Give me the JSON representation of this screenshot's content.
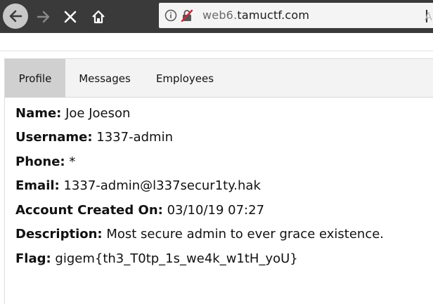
{
  "browser": {
    "url_prefix": "web6.",
    "url_domain": "tamuctf.com",
    "colors": {
      "toolbar": "#3a3a3a",
      "address_bg": "#f4f4f4",
      "insecure_icon": "#d2253a"
    },
    "icons": [
      "back-icon",
      "forward-icon",
      "close-icon",
      "home-icon",
      "info-icon",
      "insecure-lock-icon"
    ],
    "overflow_glyph": "A"
  },
  "tabs": [
    {
      "label": "Profile",
      "active": true
    },
    {
      "label": "Messages",
      "active": false
    },
    {
      "label": "Employees",
      "active": false
    }
  ],
  "profile": {
    "fields": [
      {
        "label": "Name:",
        "value": " Joe Joeson"
      },
      {
        "label": "Username:",
        "value": " 1337-admin"
      },
      {
        "label": "Phone:",
        "value": " *"
      },
      {
        "label": "Email:",
        "value": " 1337-admin@l337secur1ty.hak"
      },
      {
        "label": "Account Created On:",
        "value": " 03/10/19 07:27"
      },
      {
        "label": "Description:",
        "value": " Most secure admin to ever grace existence."
      },
      {
        "label": "Flag:",
        "value": " gigem{th3_T0tp_1s_we4k_w1tH_yoU}"
      }
    ]
  }
}
